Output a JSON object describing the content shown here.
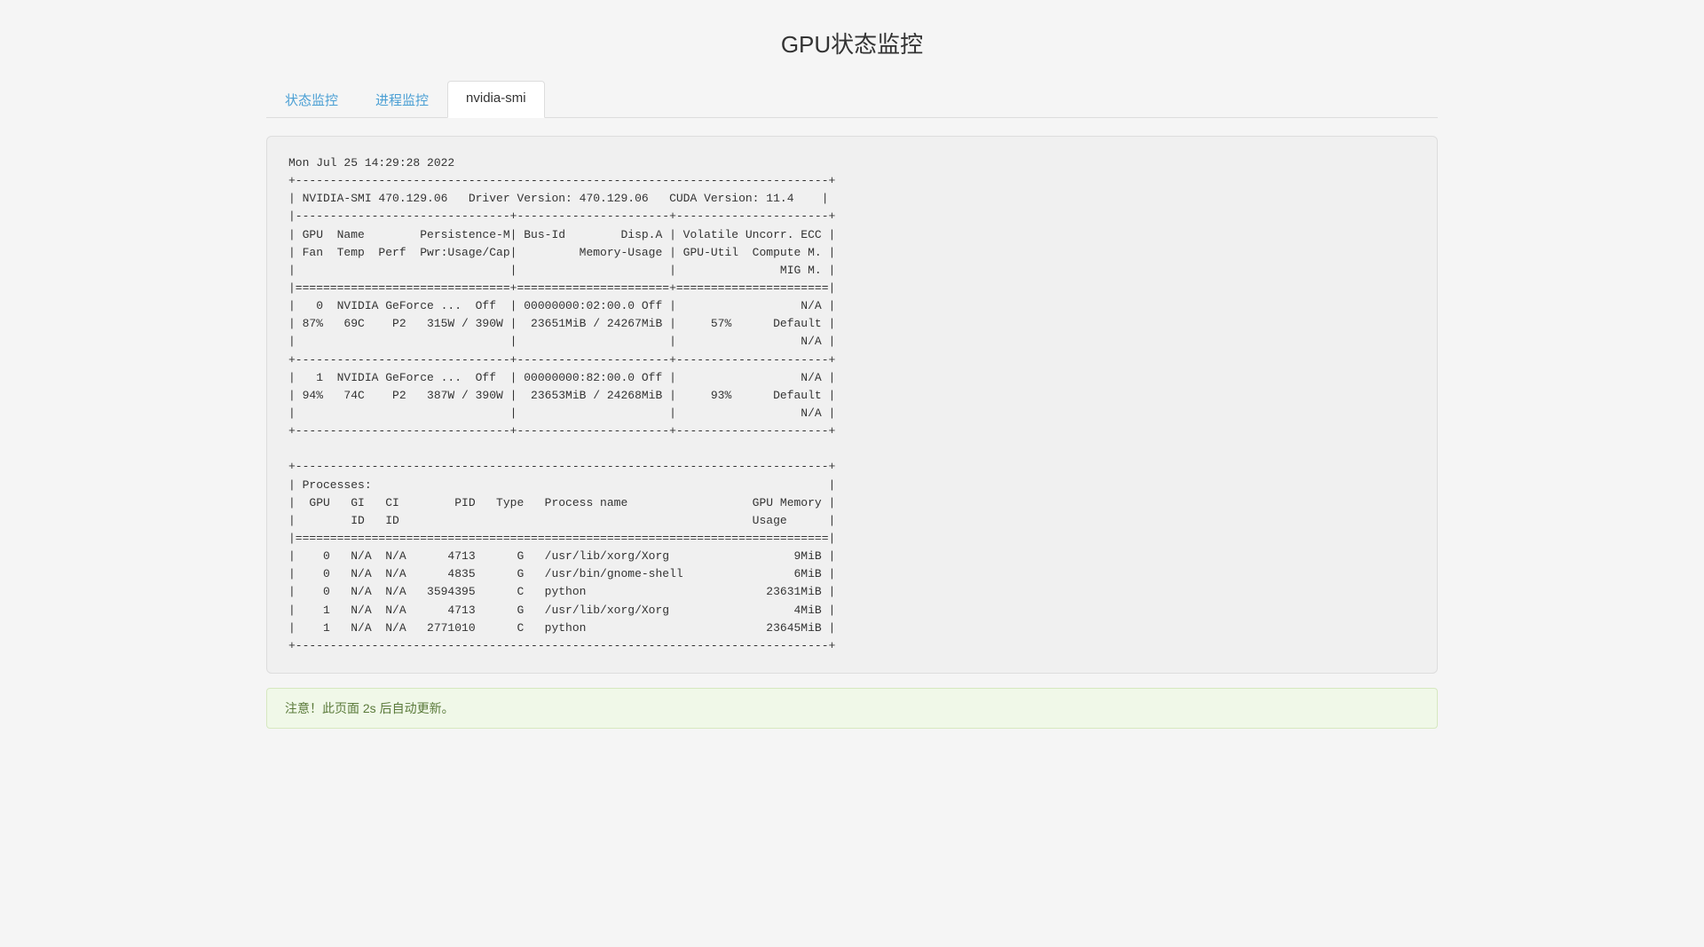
{
  "page": {
    "title": "GPU状态监控"
  },
  "tabs": [
    {
      "id": "status",
      "label": "状态监控",
      "active": false
    },
    {
      "id": "process",
      "label": "进程监控",
      "active": false
    },
    {
      "id": "nvidia-smi",
      "label": "nvidia-smi",
      "active": true
    }
  ],
  "nvidia_smi_content": "Mon Jul 25 14:29:28 2022\n+-----------------------------------------------------------------------------+\n| NVIDIA-SMI 470.129.06   Driver Version: 470.129.06   CUDA Version: 11.4    |\n|-------------------------------+----------------------+----------------------+\n| GPU  Name        Persistence-M| Bus-Id        Disp.A | Volatile Uncorr. ECC |\n| Fan  Temp  Perf  Pwr:Usage/Cap|         Memory-Usage | GPU-Util  Compute M. |\n|                               |                      |               MIG M. |\n|===============================+======================+======================|\n|   0  NVIDIA GeForce ...  Off  | 00000000:02:00.0 Off |                  N/A |\n| 87%   69C    P2   315W / 390W |  23651MiB / 24267MiB |     57%      Default |\n|                               |                      |                  N/A |\n+-------------------------------+----------------------+----------------------+\n|   1  NVIDIA GeForce ...  Off  | 00000000:82:00.0 Off |                  N/A |\n| 94%   74C    P2   387W / 390W |  23653MiB / 24268MiB |     93%      Default |\n|                               |                      |                  N/A |\n+-------------------------------+----------------------+----------------------+\n\n+-----------------------------------------------------------------------------+\n| Processes:                                                                  |\n|  GPU   GI   CI        PID   Type   Process name                  GPU Memory |\n|        ID   ID                                                   Usage      |\n|=============================================================================|\n|    0   N/A  N/A      4713      G   /usr/lib/xorg/Xorg                  9MiB |\n|    0   N/A  N/A      4835      G   /usr/bin/gnome-shell                6MiB |\n|    0   N/A  N/A   3594395      C   python                          23631MiB |\n|    1   N/A  N/A      4713      G   /usr/lib/xorg/Xorg                  4MiB |\n|    1   N/A  N/A   2771010      C   python                          23645MiB |\n+-----------------------------------------------------------------------------+",
  "notice": {
    "text": "注意！此页面 2s 后自动更新。"
  }
}
